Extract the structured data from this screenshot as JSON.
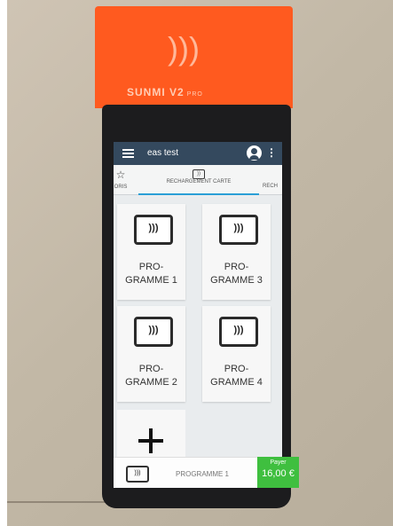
{
  "device": {
    "brand": "SUNMI V2",
    "model": "PRO"
  },
  "app_bar": {
    "title": "eas test"
  },
  "tabs": [
    {
      "label": "FAVORIS",
      "visible_text": "ORIS"
    },
    {
      "label": "RECHARGEMENT CARTE"
    },
    {
      "label": "RECH"
    }
  ],
  "tiles": [
    {
      "label": "PRO-\nGRAMME 1"
    },
    {
      "label": "PRO-\nGRAMME 3"
    },
    {
      "label": "PRO-\nGRAMME 2"
    },
    {
      "label": "PRO-\nGRAMME 4"
    }
  ],
  "bottom_bar": {
    "selected_program": "PROGRAMME 1",
    "pay_label": "Payer",
    "amount": "16,00 €"
  },
  "icons": {
    "nfc": "nfc-card-icon",
    "menu": "menu-icon",
    "account": "account-icon",
    "more": "more-vert-icon",
    "add": "plus-icon",
    "favorite": "star-icon"
  },
  "colors": {
    "device_accent": "#ff5a1f",
    "app_bar": "#34495e",
    "tab_indicator": "#2a9fd6",
    "pay_button": "#3fbf3f"
  }
}
